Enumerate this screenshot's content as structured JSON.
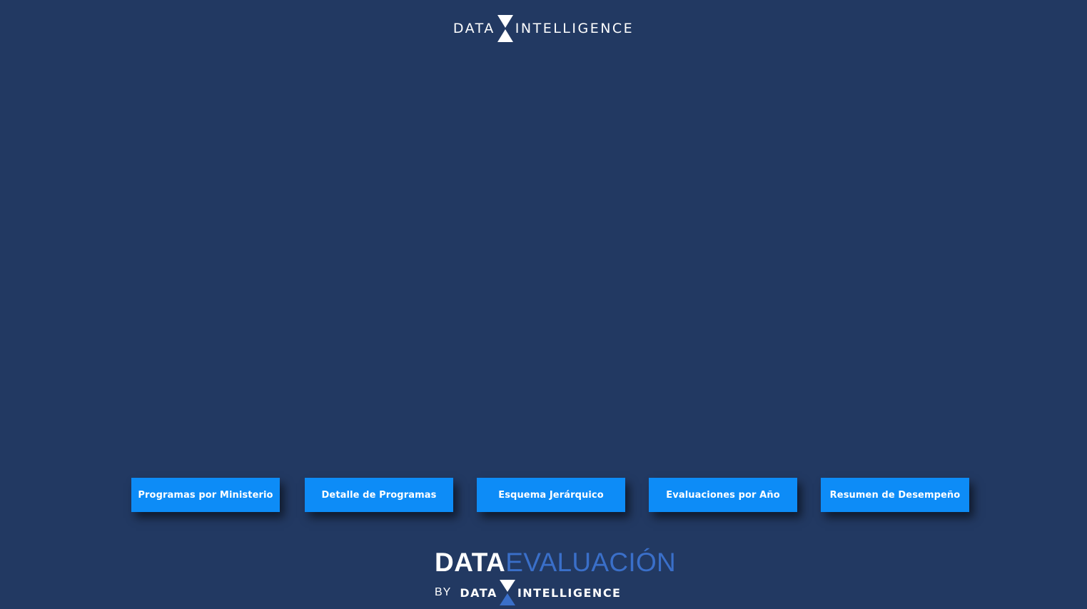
{
  "header": {
    "logo_left": "DATA",
    "logo_right": "INTELLIGENCE",
    "logo_mark": "hourglass-logo-icon"
  },
  "nav": {
    "buttons": [
      {
        "label": "Programas por Ministerio"
      },
      {
        "label": "Detalle de Programas"
      },
      {
        "label": "Esquema Jerárquico"
      },
      {
        "label": "Evaluaciones por Año"
      },
      {
        "label": "Resumen de Desempeño"
      }
    ]
  },
  "footer": {
    "brand_primary": "DATA",
    "brand_secondary": "EVALUACIÓN",
    "by_label": "BY",
    "company_left": "DATA",
    "company_right": "INTELLIGENCE"
  },
  "colors": {
    "background": "#223962",
    "button": "#0d8cf7",
    "accent": "#3a6fc9",
    "text": "#ffffff"
  }
}
